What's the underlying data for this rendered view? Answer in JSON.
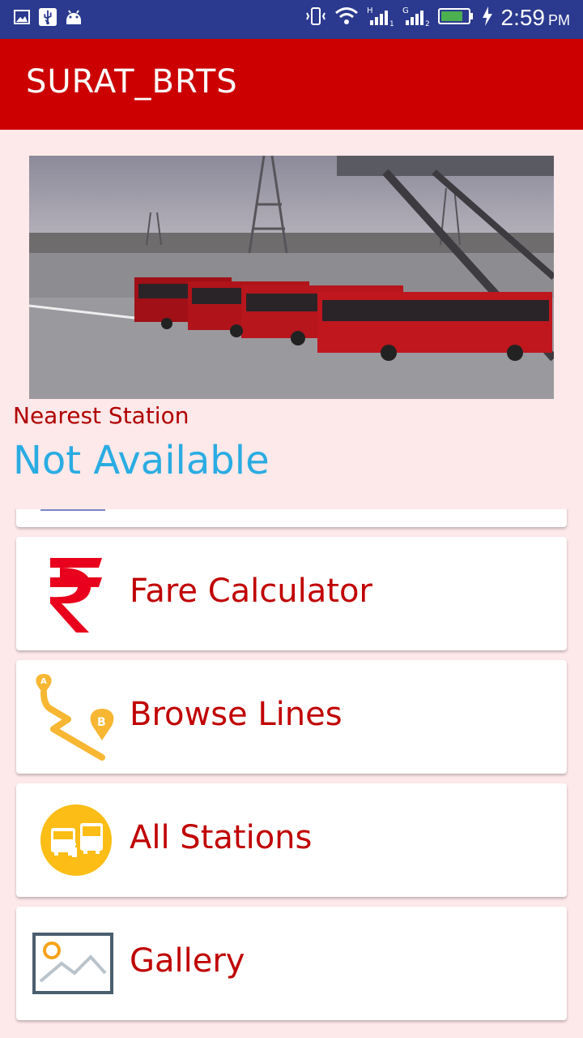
{
  "status_bar": {
    "time": "2:59",
    "ampm": "PM",
    "icons": [
      "gallery-icon",
      "usb-icon",
      "android-icon",
      "vibrate-icon",
      "wifi-icon",
      "signal-h-icon",
      "signal-g-icon",
      "battery-icon",
      "charging-icon"
    ]
  },
  "app_bar": {
    "title": "SURAT_BRTS"
  },
  "hero": {
    "image": "brts-buses-photo"
  },
  "nearest_station": {
    "label": "Nearest Station",
    "value": "Not Available"
  },
  "menu": {
    "items": [
      {
        "label": "Fare Calculator",
        "icon": "rupee-icon"
      },
      {
        "label": "Browse Lines",
        "icon": "route-a-b-icon"
      },
      {
        "label": "All Stations",
        "icon": "bus-stop-icon"
      },
      {
        "label": "Gallery",
        "icon": "gallery-image-icon"
      }
    ]
  },
  "colors": {
    "status_bar": "#2b3a8f",
    "app_bar": "#cc0000",
    "background": "#fde8ea",
    "menu_text": "#c00000",
    "nearest_value": "#2aace2"
  }
}
